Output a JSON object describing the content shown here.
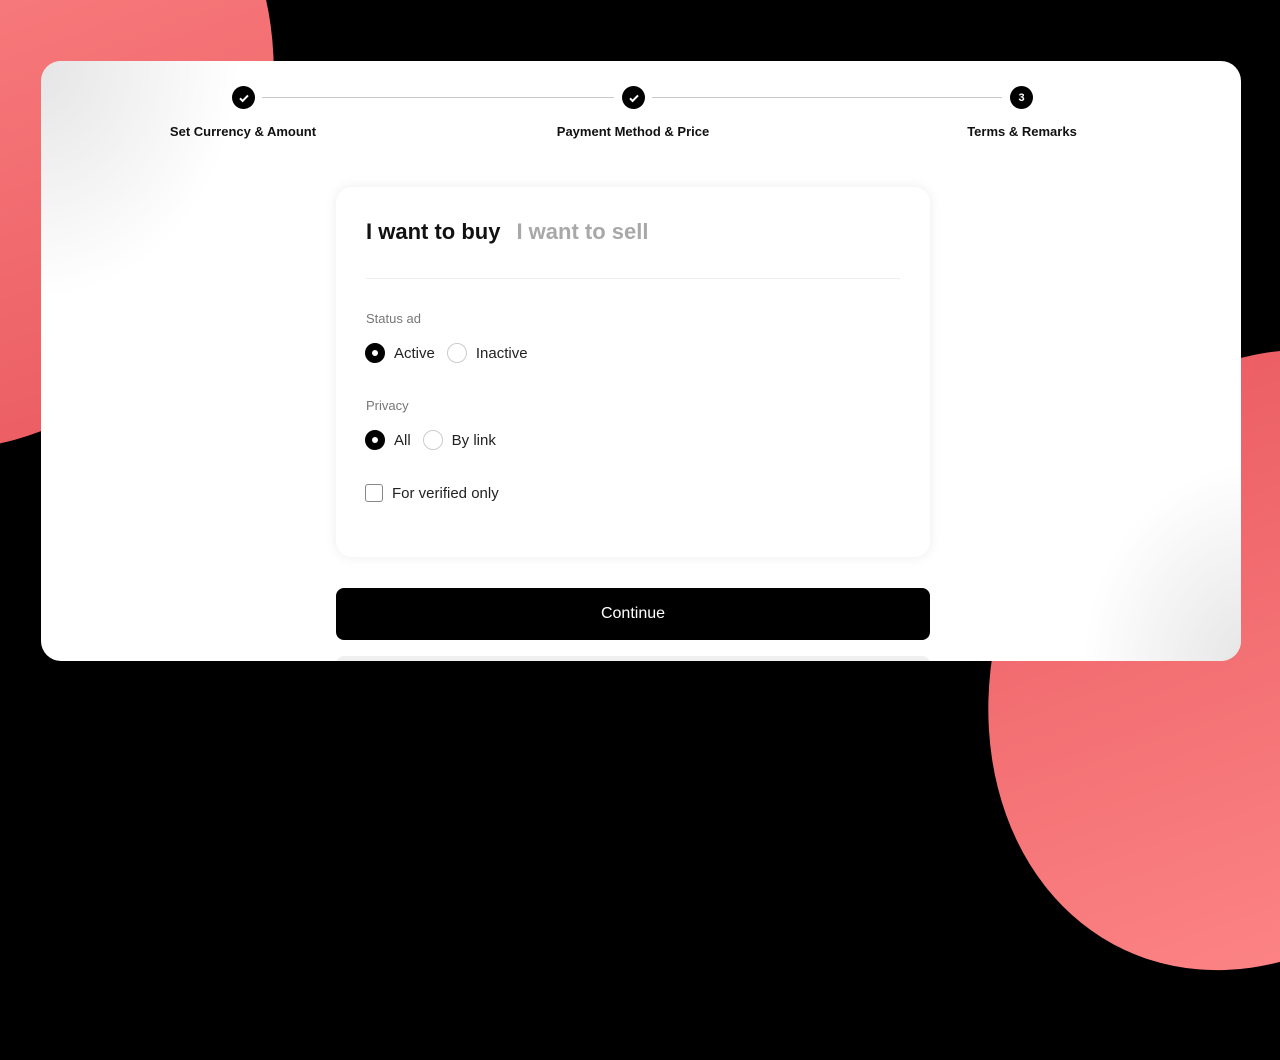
{
  "stepper": {
    "steps": [
      {
        "label": "Set Currency & Amount",
        "state": "done",
        "marker": "check-icon"
      },
      {
        "label": "Payment Method & Price",
        "state": "done",
        "marker": "check-icon"
      },
      {
        "label": "Terms & Remarks",
        "state": "current",
        "number": "3"
      }
    ]
  },
  "card": {
    "tabs": {
      "buy": "I want to buy",
      "sell": "I want to sell",
      "selected": "buy"
    },
    "status": {
      "label": "Status ad",
      "options": [
        "Active",
        "Inactive"
      ],
      "selected": "Active"
    },
    "privacy": {
      "label": "Privacy",
      "options": [
        "All",
        "By link"
      ],
      "selected": "All"
    },
    "verified": {
      "label": "For verified only",
      "checked": false
    }
  },
  "continue_label": "Continue",
  "colors": {
    "accent": "#000000",
    "background_swoosh": "#ff7a7a"
  }
}
